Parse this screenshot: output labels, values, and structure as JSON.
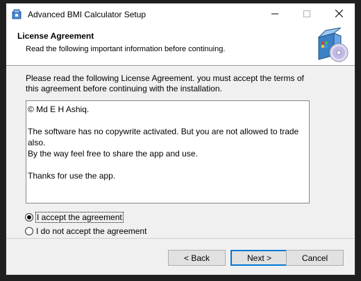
{
  "window": {
    "title": "Advanced BMI Calculator Setup",
    "icons": {
      "app": "installer-icon",
      "minimize": "minimize-icon",
      "maximize": "maximize-icon",
      "close": "close-icon"
    }
  },
  "header": {
    "title": "License Agreement",
    "subtitle": "Read the following important information before continuing.",
    "image": "setup-box-cd-icon"
  },
  "intro": "Please read the following License Agreement. you must accept the terms of this agreement before continuing with the installation.",
  "license": {
    "line1": "© Md E H Ashiq.",
    "line2": "The software has no copywrite activated. But you are not allowed to trade also.",
    "line3": "By the way feel free to share the app and use.",
    "line4": "Thanks for use the app."
  },
  "options": {
    "accept": "I accept the agreement",
    "decline": "I do not accept the agreement",
    "selected": "accept"
  },
  "buttons": {
    "back": "< Back",
    "next": "Next >",
    "cancel": "Cancel"
  },
  "colors": {
    "accent": "#0078d7",
    "window_bg": "#f0f0f0",
    "desktop_bg": "#1f1f1f"
  }
}
